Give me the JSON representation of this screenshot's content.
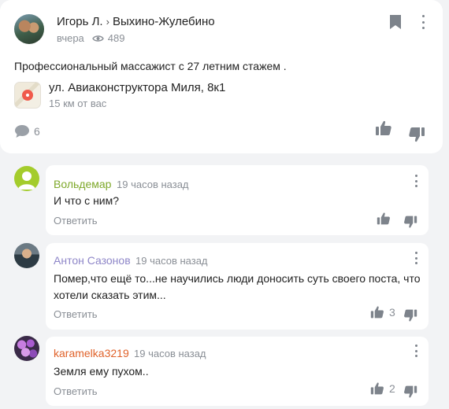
{
  "post": {
    "author": "Игорь Л.",
    "separator": "›",
    "location": "Выхино-Жулебино",
    "time": "вчера",
    "views": "489",
    "text": "Профессиональный массажист с 27 летним стажем .",
    "address": "ул. Авиаконструктора Миля, 8к1",
    "distance": "15 км от вас",
    "comments_count": "6"
  },
  "comments": [
    {
      "name": "Вольдемар",
      "name_color": "#7ea82a",
      "time": "19 часов назад",
      "text": "И что с ним?",
      "reply": "Ответить",
      "likes": ""
    },
    {
      "name": "Антон Сазонов",
      "name_color": "#8e86c8",
      "time": "19 часов назад",
      "text": "Помер,что ещё то...не научились люди доносить суть своего поста, что хотели сказать этим...",
      "reply": "Ответить",
      "likes": "3"
    },
    {
      "name": "karamelka3219",
      "name_color": "#e0622a",
      "time": "19 часов назад",
      "text": "Земля ему пухом..",
      "reply": "Ответить",
      "likes": "2"
    }
  ]
}
